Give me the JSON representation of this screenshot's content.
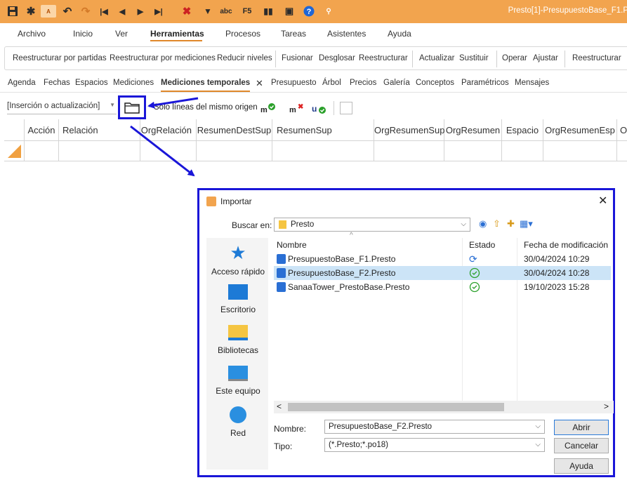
{
  "app": {
    "window_title": "Presto[1]-PresupuestoBase_F1.P"
  },
  "menu": [
    "Archivo",
    "Inicio",
    "Ver",
    "Herramientas",
    "Procesos",
    "Tareas",
    "Asistentes",
    "Ayuda"
  ],
  "ribbon": {
    "items": [
      "Reestructurar por partidas",
      "Reestructurar por mediciones",
      "Reducir niveles",
      "Fusionar",
      "Desglosar",
      "Reestructurar",
      "Actualizar",
      "Sustituir",
      "Operar",
      "Ajustar",
      "Reestructurar"
    ]
  },
  "tabs": [
    "Agenda",
    "Fechas",
    "Espacios",
    "Mediciones",
    "Mediciones temporales",
    "Presupuesto",
    "Árbol",
    "Precios",
    "Galería",
    "Conceptos",
    "Paramétricos",
    "Mensajes"
  ],
  "toolbar": {
    "mode_select": "[Inserción o actualización]",
    "same_origin_checkbox": "Solo líneas del mismo origen"
  },
  "grid": {
    "columns": [
      "Acción",
      "Relación",
      "OrgRelación",
      "ResumenDestSup",
      "ResumenSup",
      "OrgResumenSup",
      "OrgResumen",
      "Espacio",
      "OrgResumenEsp",
      "O"
    ]
  },
  "dialog": {
    "title": "Importar",
    "look_in_label": "Buscar en:",
    "look_in_value": "Presto",
    "sidebar": [
      "Acceso rápido",
      "Escritorio",
      "Bibliotecas",
      "Este equipo",
      "Red"
    ],
    "columns": [
      "Nombre",
      "Estado",
      "Fecha de modificación"
    ],
    "files": [
      {
        "name": "PresupuestoBase_F1.Presto",
        "date": "30/04/2024 10:29"
      },
      {
        "name": "PresupuestoBase_F2.Presto",
        "date": "30/04/2024 10:28"
      },
      {
        "name": "SanaaTower_PrestoBase.Presto",
        "date": "19/10/2023 15:28"
      }
    ],
    "name_label": "Nombre:",
    "name_value": "PresupuestoBase_F2.Presto",
    "type_label": "Tipo:",
    "type_value": "(*.Presto;*.po18)",
    "buttons": {
      "open": "Abrir",
      "cancel": "Cancelar",
      "help": "Ayuda"
    }
  },
  "colors": {
    "titlebar": "#f2a44e",
    "highlight": "#1a16d8",
    "accent_underline": "#e0882a",
    "selected_row": "#cce4f7"
  }
}
